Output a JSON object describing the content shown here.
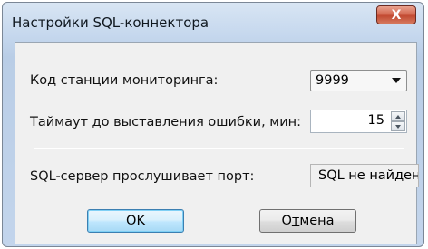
{
  "window": {
    "title": "Настройки SQL-коннектора",
    "close_icon": "close-icon",
    "close_glyph": "X",
    "accent_close": "#c24a32"
  },
  "form": {
    "station_code_label": "Код станции мониторинга:",
    "station_code_value": "9999",
    "timeout_label": "Таймаут до выставления ошибки, мин:",
    "timeout_value": "15",
    "port_label": "SQL-сервер прослушивает порт:",
    "port_value": "SQL не найден"
  },
  "buttons": {
    "ok_label": "OK",
    "cancel_prefix": "О",
    "cancel_underlined": "т",
    "cancel_suffix": "мена"
  }
}
